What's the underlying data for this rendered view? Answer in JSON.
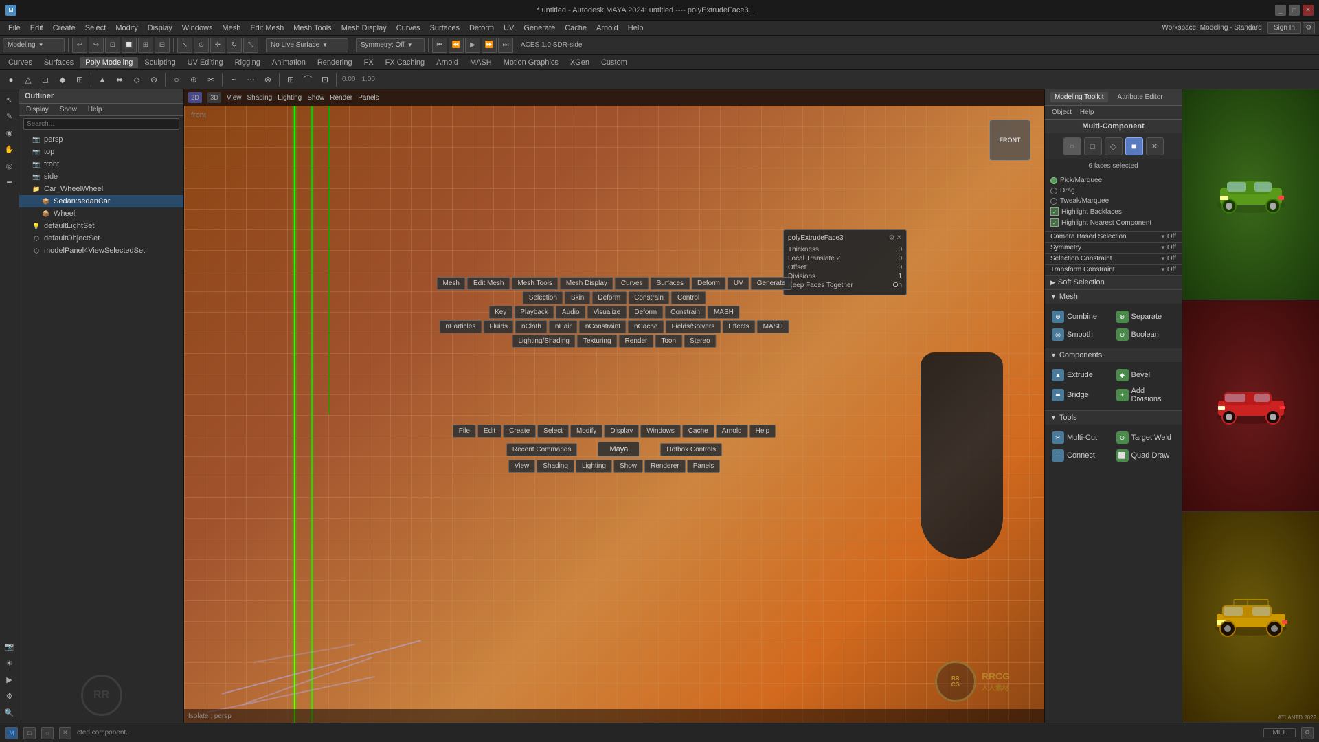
{
  "titlebar": {
    "title": "* untitled - Autodesk MAYA 2024: untitled  ----  polyExtrudeFace3...",
    "winControls": [
      "_",
      "□",
      "✕"
    ]
  },
  "menubar": {
    "items": [
      "File",
      "Edit",
      "Create",
      "Select",
      "Modify",
      "Display",
      "Windows",
      "Mesh",
      "Edit Mesh",
      "Mesh Tools",
      "Mesh Display",
      "Curves",
      "Surfaces",
      "Deform",
      "UV",
      "Generate",
      "Cache",
      "Arnold",
      "Help"
    ]
  },
  "toolbar1": {
    "workspace": "Workspace: Modeling - Standard",
    "symmetry": "Symmetry: Off",
    "liveMode": "No Live Surface",
    "signIn": "Sign In"
  },
  "tabs": {
    "items": [
      "Curves",
      "Surfaces",
      "Poly Modeling",
      "Sculpting",
      "UV Editing",
      "Rigging",
      "Animation",
      "Rendering",
      "FX",
      "FX Caching",
      "Arnold",
      "MASH",
      "Motion Graphics",
      "XGen",
      "Custom"
    ]
  },
  "viewport": {
    "menus": [
      "View",
      "Shading",
      "Lighting",
      "Show",
      "Render",
      "Panels"
    ],
    "frontLabel": "front",
    "bottomLabel": "Isolate : persp",
    "cubeLabel": "FRONT"
  },
  "outliner": {
    "title": "Outliner",
    "menuItems": [
      "Display",
      "Show",
      "Help"
    ],
    "searchPlaceholder": "Search...",
    "items": [
      {
        "label": "persp",
        "indent": 1,
        "icon": "👁"
      },
      {
        "label": "top",
        "indent": 1,
        "icon": "👁"
      },
      {
        "label": "front",
        "indent": 1,
        "icon": "👁"
      },
      {
        "label": "side",
        "indent": 1,
        "icon": "👁"
      },
      {
        "label": "Car_WheelWheel",
        "indent": 1,
        "icon": "📁"
      },
      {
        "label": "Sedan:sedanCar",
        "indent": 2,
        "icon": "📁",
        "selected": true
      },
      {
        "label": "Wheel",
        "indent": 2,
        "icon": "📁"
      },
      {
        "label": "defaultLightSet",
        "indent": 1,
        "icon": "💡"
      },
      {
        "label": "defaultObjectSet",
        "indent": 1,
        "icon": "⬡"
      },
      {
        "label": "modelPanel4ViewSelectedSet",
        "indent": 1,
        "icon": "⬡"
      }
    ]
  },
  "hotbox": {
    "center": {
      "maya": "Maya",
      "recentCommands": "Recent Commands",
      "hotboxControls": "Hotbox Controls"
    },
    "topMenus": [
      "Mesh",
      "Edit Mesh",
      "Mesh Tools",
      "Mesh Display",
      "Curves",
      "Surfaces",
      "Deform",
      "UV",
      "Generate"
    ],
    "topMenus2": [
      "Selection",
      "Skin",
      "Deform",
      "Constrain",
      "Control"
    ],
    "topMenus3": [
      "Key",
      "Playback",
      "Audio",
      "Visualize",
      "Deform",
      "Constrain",
      "MASH"
    ],
    "topMenus4": [
      "nParticles",
      "Fluids",
      "nCloth",
      "nHair",
      "nConstraint",
      "nCache",
      "Fields/Solvers",
      "Effects",
      "MASH"
    ],
    "topMenus5": [
      "Lighting/Shading",
      "Texturing",
      "Render",
      "Toon",
      "Stereo"
    ],
    "mainMenus": [
      "File",
      "Edit",
      "Create",
      "Select",
      "Modify",
      "Display",
      "Windows",
      "Cache",
      "Arnold",
      "Help"
    ],
    "viewMenus": [
      "View",
      "Shading",
      "Lighting",
      "Show",
      "Renderer",
      "Panels"
    ]
  },
  "polyPopup": {
    "title": "polyExtrudeFace3",
    "fields": [
      {
        "label": "Thickness",
        "value": "0"
      },
      {
        "label": "Local Translate Z",
        "value": "0"
      },
      {
        "label": "Offset",
        "value": "0"
      },
      {
        "label": "Divisions",
        "value": "1"
      },
      {
        "label": "Keep Faces Together",
        "value": "On"
      }
    ]
  },
  "rightPanel": {
    "tabs": [
      "Modeling Toolkit",
      "Attribute Editor"
    ],
    "objectHelp": [
      "Object",
      "Help"
    ],
    "subtitle": "Multi-Component",
    "status": "6 faces selected",
    "modeIcons": [
      "○",
      "□",
      "◇",
      "■",
      "✕"
    ],
    "options": {
      "pickMarquee": {
        "label": "Pick/Marquee",
        "active": true
      },
      "drag": {
        "label": "Drag",
        "active": false
      },
      "tweakMarquee": {
        "label": "Tweak/Marquee",
        "active": false
      },
      "highlightBackfaces": {
        "label": "Highlight Backfaces",
        "checked": true
      },
      "highlightNearest": {
        "label": "Highlight Nearest Component",
        "checked": true
      }
    },
    "cameraBasedSelection": {
      "label": "Camera Based Selection",
      "value": "Off"
    },
    "symmetry": {
      "label": "Symmetry",
      "value": "Off"
    },
    "selectionConstraint": {
      "label": "Selection Constraint",
      "value": "Off"
    },
    "transformConstraint": {
      "label": "Transform Constraint",
      "value": "Off"
    },
    "softSelection": {
      "label": "Soft Selection"
    },
    "mesh": {
      "title": "Mesh",
      "tools": [
        {
          "label": "Combine",
          "icon": "⊕"
        },
        {
          "label": "Separate",
          "icon": "⊗"
        },
        {
          "label": "Smooth",
          "icon": "◎"
        },
        {
          "label": "Boolean",
          "icon": "⊖"
        }
      ]
    },
    "components": {
      "title": "Components",
      "tools": [
        {
          "label": "Extrude",
          "icon": "▲"
        },
        {
          "label": "Bevel",
          "icon": "◆"
        },
        {
          "label": "Bridge",
          "icon": "⬌"
        },
        {
          "label": "Add Divisions",
          "icon": "+"
        }
      ]
    },
    "tools": {
      "title": "Tools",
      "items": [
        {
          "label": "Multi-Cut",
          "icon": "✂"
        },
        {
          "label": "Target Weld",
          "icon": "⊙"
        },
        {
          "label": "Connect",
          "icon": "⋯"
        },
        {
          "label": "Quad Draw",
          "icon": "⬜"
        }
      ]
    }
  },
  "statusbar": {
    "message": "cted component.",
    "mode": "MEL"
  },
  "carSidebar": {
    "cars": [
      {
        "color": "green",
        "label": ""
      },
      {
        "color": "red",
        "label": ""
      },
      {
        "color": "yellow",
        "label": "ATLANTD 2022"
      }
    ]
  }
}
